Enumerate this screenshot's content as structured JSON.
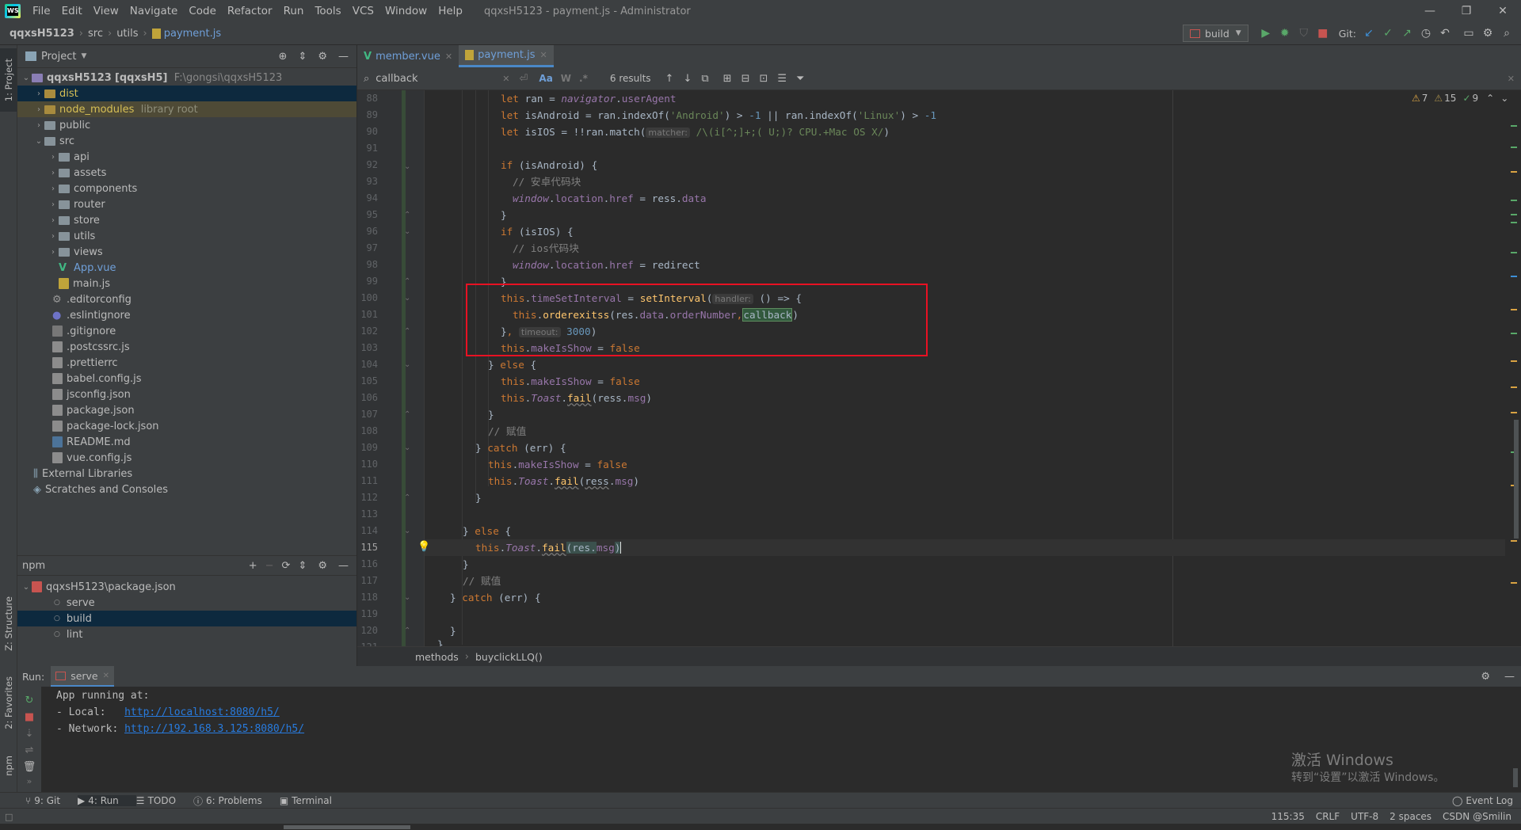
{
  "titlebar": {
    "logo": "WS",
    "menu": [
      "File",
      "Edit",
      "View",
      "Navigate",
      "Code",
      "Refactor",
      "Run",
      "Tools",
      "VCS",
      "Window",
      "Help"
    ],
    "title": "qqxsH5123 - payment.js - Administrator",
    "controls": [
      "—",
      "❐",
      "✕"
    ]
  },
  "navbar": {
    "crumbs": [
      "qqxsH5123",
      "src",
      "utils",
      "payment.js"
    ],
    "run_config": "build",
    "git_label": "Git:"
  },
  "left_strip": {
    "project": "1: Project",
    "structure": "Z: Structure",
    "favorites": "2: Favorites",
    "npm": "npm"
  },
  "project": {
    "header": "Project",
    "root_name": "qqxsH5123",
    "root_module": "[qqxsH5]",
    "root_path": "F:\\gongsi\\qqxsH5123",
    "items": [
      {
        "label": "dist",
        "extra": ""
      },
      {
        "label": "node_modules",
        "extra": "library root"
      },
      {
        "label": "public",
        "extra": ""
      },
      {
        "label": "src",
        "extra": ""
      },
      {
        "label": "api",
        "extra": ""
      },
      {
        "label": "assets",
        "extra": ""
      },
      {
        "label": "components",
        "extra": ""
      },
      {
        "label": "router",
        "extra": ""
      },
      {
        "label": "store",
        "extra": ""
      },
      {
        "label": "utils",
        "extra": ""
      },
      {
        "label": "views",
        "extra": ""
      },
      {
        "label": "App.vue",
        "extra": ""
      },
      {
        "label": "main.js",
        "extra": ""
      },
      {
        "label": ".editorconfig",
        "extra": ""
      },
      {
        "label": ".eslintignore",
        "extra": ""
      },
      {
        "label": ".gitignore",
        "extra": ""
      },
      {
        "label": ".postcssrc.js",
        "extra": ""
      },
      {
        "label": ".prettierrc",
        "extra": ""
      },
      {
        "label": "babel.config.js",
        "extra": ""
      },
      {
        "label": "jsconfig.json",
        "extra": ""
      },
      {
        "label": "package.json",
        "extra": ""
      },
      {
        "label": "package-lock.json",
        "extra": ""
      },
      {
        "label": "README.md",
        "extra": ""
      },
      {
        "label": "vue.config.js",
        "extra": ""
      },
      {
        "label": "External Libraries",
        "extra": ""
      },
      {
        "label": "Scratches and Consoles",
        "extra": ""
      }
    ]
  },
  "npm": {
    "header": "npm",
    "root": "qqxsH5123\\package.json",
    "scripts": [
      "serve",
      "build",
      "lint"
    ]
  },
  "editor": {
    "tabs": [
      "member.vue",
      "payment.js"
    ],
    "find": {
      "query": "callback",
      "results": "6 results"
    },
    "inspections": {
      "warnings": "7",
      "weak": "15",
      "ok": "9"
    },
    "lines": [
      "88",
      "89",
      "90",
      "91",
      "92",
      "93",
      "94",
      "95",
      "96",
      "97",
      "98",
      "99",
      "100",
      "101",
      "102",
      "103",
      "104",
      "105",
      "106",
      "107",
      "108",
      "109",
      "110",
      "111",
      "112",
      "113",
      "114",
      "115",
      "116",
      "117",
      "118",
      "119",
      "120",
      "121"
    ],
    "code": {
      "l88_a": "let ",
      "l88_b": "ran",
      "l88_c": " = ",
      "l88_d": "navigator",
      "l88_e": ".",
      "l88_f": "userAgent",
      "l89_a": "let ",
      "l89_b": "isAndroid = ran.",
      "l89_c": "indexOf",
      "l89_d": "(",
      "l89_e": "'Android'",
      "l89_f": ") > ",
      "l89_g": "-1",
      "l89_h": " || ran.",
      "l89_i": "indexOf",
      "l89_j": "(",
      "l89_k": "'Linux'",
      "l89_l": ") > ",
      "l89_m": "-1",
      "l90_a": "let ",
      "l90_b": "isIOS = !!ran.",
      "l90_c": "match",
      "l90_d": "(",
      "l90_hint": "matcher:",
      "l90_e": " /\\(i[^;]+;( U;)? CPU.+Mac OS X/",
      "l90_f": ")",
      "l92_a": "if ",
      "l92_b": "(isAndroid) {",
      "l93": "// 安卓代码块",
      "l94_a": "window",
      "l94_b": ".",
      "l94_c": "location",
      "l94_d": ".",
      "l94_e": "href",
      "l94_f": " = ress.",
      "l94_g": "data",
      "l95": "}",
      "l96_a": "if ",
      "l96_b": "(isIOS) {",
      "l97": "// ios代码块",
      "l98_a": "window",
      "l98_b": ".",
      "l98_c": "location",
      "l98_d": ".",
      "l98_e": "href",
      "l98_f": " = redirect",
      "l99": "}",
      "l100_a": "this",
      "l100_b": ".",
      "l100_c": "timeSetInterval",
      "l100_d": " = ",
      "l100_e": "setInterval",
      "l100_f": "(",
      "l100_hint": "handler:",
      "l100_g": " () => {",
      "l101_a": "this",
      "l101_b": ".",
      "l101_c": "orderexitss",
      "l101_d": "(res.",
      "l101_e": "data",
      "l101_f": ".",
      "l101_g": "orderNumber",
      "l101_h": ",",
      "l101_i": "callback",
      "l101_j": ")",
      "l102_a": "}",
      "l102_b": ", ",
      "l102_hint": "timeout:",
      "l102_c": " 3000",
      "l102_d": ")",
      "l103_a": "this",
      "l103_b": ".",
      "l103_c": "makeIsShow",
      "l103_d": " = ",
      "l103_e": "false",
      "l104_a": "} ",
      "l104_b": "else ",
      "l104_c": "{",
      "l105_a": "this",
      "l105_b": ".",
      "l105_c": "makeIsShow",
      "l105_d": " = ",
      "l105_e": "false",
      "l106_a": "this",
      "l106_b": ".",
      "l106_c": "Toast",
      "l106_d": ".",
      "l106_e": "fail",
      "l106_f": "(ress.",
      "l106_g": "msg",
      "l106_h": ")",
      "l107": "}",
      "l108": "// 赋值",
      "l109_a": "} ",
      "l109_b": "catch ",
      "l109_c": "(err) {",
      "l110_a": "this",
      "l110_b": ".",
      "l110_c": "makeIsShow",
      "l110_d": " = ",
      "l110_e": "false",
      "l111_a": "this",
      "l111_b": ".",
      "l111_c": "Toast",
      "l111_d": ".",
      "l111_e": "fail",
      "l111_f": "(",
      "l111_g": "ress",
      "l111_h": ".",
      "l111_i": "msg",
      "l111_j": ")",
      "l112": "}",
      "l114_a": "} ",
      "l114_b": "else ",
      "l114_c": "{",
      "l115_a": "this",
      "l115_b": ".",
      "l115_c": "Toast",
      "l115_d": ".",
      "l115_e": "fail",
      "l115_f": "(res.",
      "l115_g": "msg",
      "l115_h": ")",
      "l116": "}",
      "l117": "// 赋值",
      "l118_a": "} ",
      "l118_b": "catch ",
      "l118_c": "(err) {",
      "l120": "}",
      "l121": "}"
    },
    "breadcrumb": [
      "methods",
      "buyclickLLQ()"
    ]
  },
  "run": {
    "label": "Run:",
    "tab": "serve",
    "output": {
      "line1": "App running at:",
      "local_label": "- Local:   ",
      "local_url": "http://localhost:8080/h5/",
      "network_label": "- Network: ",
      "network_url": "http://192.168.3.125:8080/h5/"
    }
  },
  "watermark": {
    "line1": "激活 Windows",
    "line2": "转到“设置”以激活 Windows。"
  },
  "bottom_tabs": [
    {
      "label": "9: Git",
      "icon": "git-icon"
    },
    {
      "label": "4: Run",
      "icon": "run-icon"
    },
    {
      "label": "TODO",
      "icon": "todo-icon"
    },
    {
      "label": "6: Problems",
      "icon": "problems-icon"
    },
    {
      "label": "Terminal",
      "icon": "terminal-icon"
    }
  ],
  "event_log": "Event Log",
  "status": {
    "position": "115:35",
    "line_sep": "CRLF",
    "encoding": "UTF-8",
    "indent": "2 spaces",
    "branch": "CSDN @Smilin"
  },
  "colors": {
    "accent": "#4a88c7",
    "highlight_box": "#e81123",
    "keyword": "#cc7832",
    "property": "#9876aa",
    "function": "#ffc66d",
    "string": "#6a8759",
    "number": "#6897bb"
  }
}
